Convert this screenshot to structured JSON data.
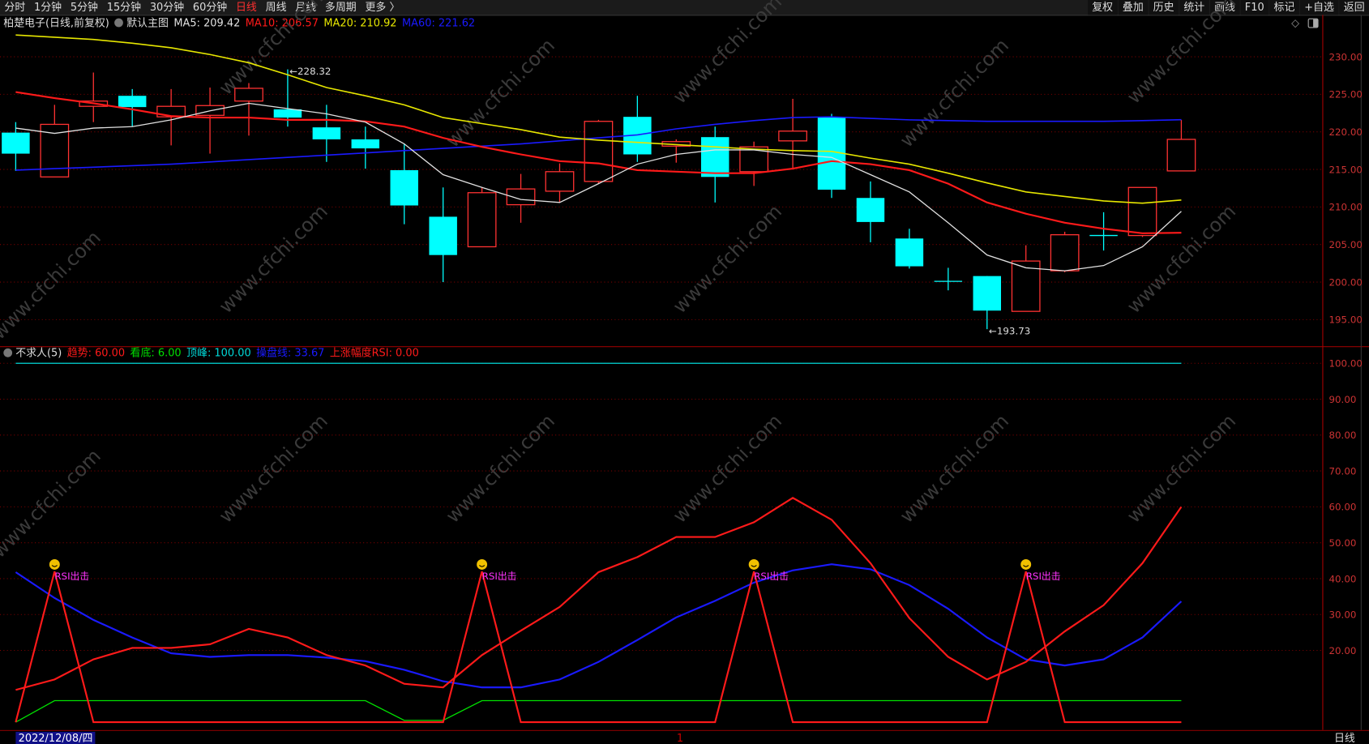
{
  "toolbar": {
    "tabs": [
      "分时",
      "1分钟",
      "5分钟",
      "15分钟",
      "30分钟",
      "60分钟",
      "日线",
      "周线",
      "月线",
      "多周期",
      "更多 〉"
    ],
    "active_tab": "日线",
    "right_buttons": [
      "复权",
      "叠加",
      "历史",
      "统计",
      "画线",
      "F10",
      "标记",
      "+自选",
      "返回"
    ]
  },
  "main_legend": {
    "title": "柏楚电子(日线,前复权)",
    "template": "默认主图",
    "ma5": "MA5: 209.42",
    "ma10": "MA10: 206.57",
    "ma20": "MA20: 210.92",
    "ma60": "MA60: 221.62"
  },
  "indicator_legend": {
    "name": "不求人(5)",
    "trend": "趋势: 60.00",
    "bottom": "看底: 6.00",
    "peak": "顶峰: 100.00",
    "operate": "操盘线: 33.67",
    "rsi": "上涨幅度RSI: 0.00"
  },
  "colors": {
    "up": "#ff3232",
    "down": "#00ffff",
    "ma5": "#e0e0e0",
    "ma10": "#ff1a1a",
    "ma20": "#e6e600",
    "ma60": "#1a1aff",
    "grid": "#7a0000"
  },
  "status": {
    "date": "2022/12/08/四",
    "period": "日线",
    "marker": "1"
  },
  "watermark": "www.cfchi.com",
  "chart_data": [
    {
      "type": "candlestick",
      "ylim": [
        193,
        232
      ],
      "yticks": [
        "195.00",
        "200.00",
        "205.00",
        "210.00",
        "215.00",
        "220.00",
        "225.00",
        "230.00"
      ],
      "ohlc": [
        [
          219.9,
          221.3,
          214.8,
          217.1
        ],
        [
          214,
          223.6,
          214,
          221
        ],
        [
          223.4,
          227.9,
          221.3,
          224.1
        ],
        [
          224.8,
          225.7,
          220.7,
          223.3
        ],
        [
          222,
          225.7,
          218.2,
          223.4
        ],
        [
          222.2,
          225.9,
          217.1,
          223.5
        ],
        [
          224.1,
          226.5,
          219.5,
          225.8
        ],
        [
          223,
          228.32,
          220.7,
          221.9
        ],
        [
          220.6,
          223.6,
          216,
          219
        ],
        [
          219,
          220.7,
          215.1,
          217.8
        ],
        [
          214.9,
          218.4,
          207.7,
          210.2
        ],
        [
          208.7,
          212.6,
          200,
          203.6
        ],
        [
          204.7,
          212.6,
          204.7,
          211.9
        ],
        [
          210.3,
          214.4,
          207.9,
          212.4
        ],
        [
          212.1,
          215.8,
          210.6,
          214.7
        ],
        [
          213.4,
          221.6,
          213.1,
          221.4
        ],
        [
          222,
          224.8,
          216,
          217
        ],
        [
          218.1,
          219,
          215.9,
          218.7
        ],
        [
          219.3,
          220.7,
          210.6,
          214
        ],
        [
          214.7,
          218.7,
          212.8,
          218
        ],
        [
          218.8,
          224.4,
          215.1,
          220.1
        ],
        [
          222,
          222.4,
          211.2,
          212.3
        ],
        [
          211.2,
          213.4,
          205.3,
          208
        ],
        [
          205.8,
          207.1,
          201.8,
          202.1
        ],
        [
          200.1,
          201.9,
          198.9,
          200.1
        ],
        [
          200.8,
          200.8,
          193.73,
          196.2
        ],
        [
          196.1,
          204.9,
          196.1,
          202.8
        ],
        [
          201.5,
          206.7,
          201.3,
          206.3
        ],
        [
          206.2,
          209.3,
          204.2,
          206.2
        ],
        [
          206.2,
          212.6,
          206,
          212.6
        ],
        [
          214.8,
          221.6,
          214.8,
          219
        ]
      ],
      "ma5": [
        220.5,
        219.8,
        220.5,
        220.7,
        221.6,
        222.8,
        223.8,
        223.1,
        222.4,
        221.3,
        218.4,
        214.3,
        212.6,
        211,
        210.6,
        213.1,
        215.7,
        217,
        217.6,
        217.6,
        217,
        216.6,
        214.3,
        212,
        207.9,
        203.6,
        201.9,
        201.5,
        202.2,
        204.7,
        209.42
      ],
      "ma10": [
        225.3,
        224.5,
        223.8,
        223,
        222.1,
        221.9,
        221.9,
        221.6,
        221.6,
        221.4,
        220.7,
        219.2,
        218,
        217,
        216.1,
        215.8,
        214.9,
        214.7,
        214.5,
        214.5,
        215.1,
        216.1,
        215.7,
        214.9,
        213.1,
        210.6,
        209.1,
        207.9,
        207.1,
        206.5,
        206.57
      ],
      "ma20": [
        232.9,
        232.6,
        232.3,
        231.8,
        231.2,
        230.3,
        229.2,
        227.6,
        225.9,
        224.8,
        223.6,
        221.9,
        221.1,
        220.3,
        219.3,
        218.9,
        218.6,
        218.3,
        218,
        217.7,
        217.5,
        217.4,
        216.5,
        215.7,
        214.5,
        213.2,
        212,
        211.4,
        210.8,
        210.5,
        210.92
      ],
      "ma60": [
        214.9,
        215.1,
        215.3,
        215.5,
        215.7,
        216,
        216.3,
        216.6,
        216.9,
        217.2,
        217.5,
        217.8,
        218.1,
        218.4,
        218.8,
        219.2,
        219.6,
        220.4,
        221,
        221.5,
        221.9,
        222,
        221.8,
        221.6,
        221.5,
        221.4,
        221.4,
        221.4,
        221.4,
        221.5,
        221.62
      ],
      "annotations": [
        {
          "index": 7,
          "label": "228.32"
        },
        {
          "index": 25,
          "label": "193.73"
        }
      ]
    },
    {
      "type": "line",
      "ylim": [
        0,
        100
      ],
      "yticks": [
        "20.00",
        "30.00",
        "40.00",
        "50.00",
        "60.00",
        "70.00",
        "80.00",
        "90.00",
        "100.00"
      ],
      "trend": [
        9,
        11.9,
        17.5,
        20.7,
        20.7,
        21.7,
        26,
        23.6,
        18.7,
        15.8,
        10.7,
        9.7,
        18.7,
        25.5,
        32.1,
        41.8,
        46,
        51.6,
        51.6,
        55.7,
        62.5,
        56.4,
        44.3,
        29,
        18.2,
        11.9,
        16.8,
        25.3,
        32.6,
        44.3,
        60
      ],
      "operate": [
        41.8,
        34.6,
        28.5,
        23.6,
        19.2,
        18.2,
        18.7,
        18.7,
        18,
        17,
        14.6,
        11.4,
        9.7,
        9.7,
        11.9,
        16.8,
        22.9,
        29.2,
        33.8,
        38.9,
        42.3,
        44,
        42.6,
        38.2,
        31.6,
        23.6,
        17.5,
        15.8,
        17.5,
        23.6,
        33.67
      ],
      "bottom": [
        0,
        6,
        6,
        6,
        6,
        6,
        6,
        6,
        6,
        6,
        0.5,
        0.5,
        6,
        6,
        6,
        6,
        6,
        6,
        6,
        6,
        6,
        6,
        6,
        6,
        6,
        6,
        6,
        6,
        6,
        6,
        6
      ],
      "peak": 100,
      "rsi": [
        0,
        42,
        0,
        0,
        0,
        0,
        0,
        0,
        0,
        0,
        0,
        0,
        42,
        0,
        0,
        0,
        0,
        0,
        0,
        42,
        0,
        0,
        0,
        0,
        0,
        0,
        42,
        0,
        0,
        0,
        0
      ],
      "signals": [
        {
          "index": 1,
          "label": "RSI出击"
        },
        {
          "index": 12,
          "label": "RSI出击"
        },
        {
          "index": 19,
          "label": "RSI出击"
        },
        {
          "index": 26,
          "label": "RSI出击"
        }
      ]
    }
  ]
}
